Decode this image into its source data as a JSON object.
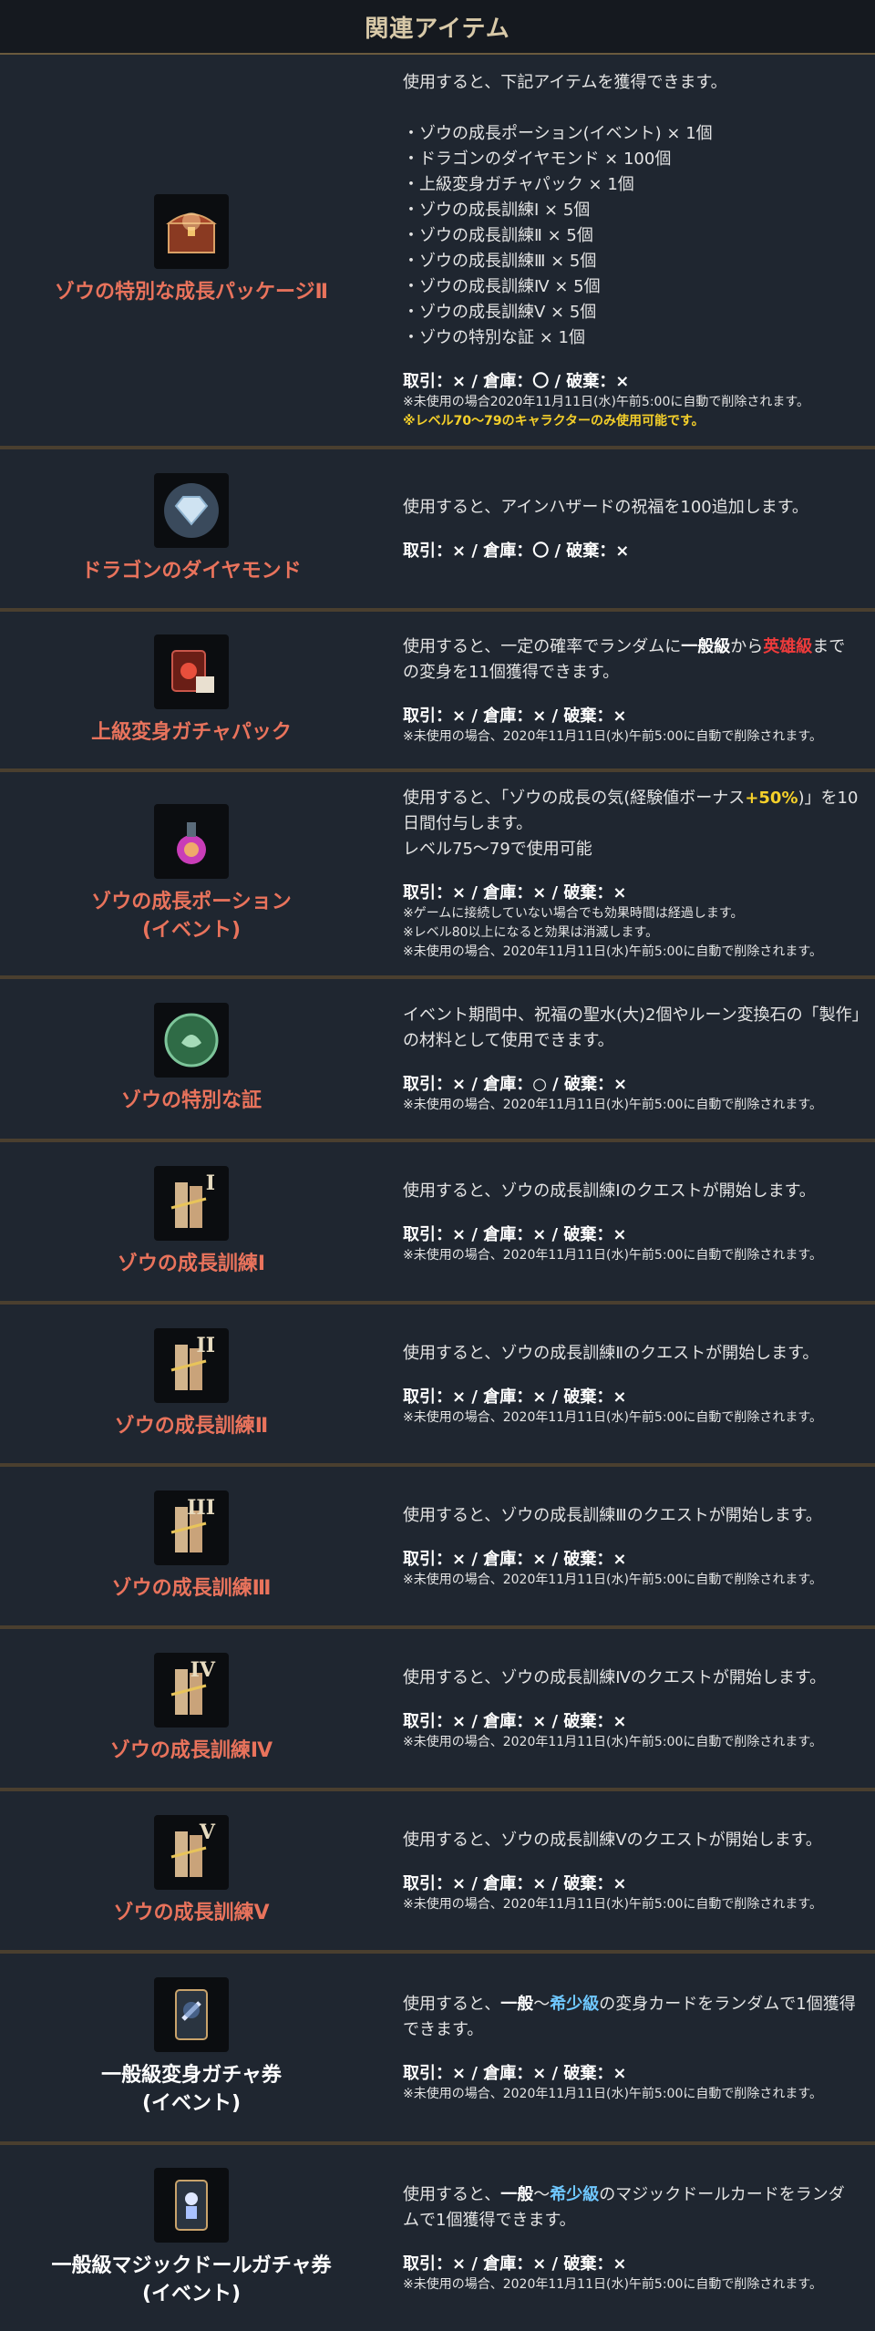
{
  "header": {
    "title": "関連アイテム"
  },
  "items": [
    {
      "name": "ゾウの特別な成長パッケージⅡ",
      "desc": "使用すると、下記アイテムを獲得できます。",
      "list": [
        "・ゾウの成長ポーション(イベント) × 1個",
        "・ドラゴンのダイヤモンド × 100個",
        "・上級変身ガチャパック × 1個",
        "・ゾウの成長訓練Ⅰ × 5個",
        "・ゾウの成長訓練Ⅱ × 5個",
        "・ゾウの成長訓練Ⅲ × 5個",
        "・ゾウの成長訓練Ⅳ × 5個",
        "・ゾウの成長訓練Ⅴ × 5個",
        "・ゾウの特別な証 × 1個"
      ],
      "meta": "取引：× / 倉庫：〇 / 破棄：×",
      "note1": "※未使用の場合2020年11月11日(水)午前5:00に自動で削除されます。",
      "note2": "※レベル70～79のキャラクターのみ使用可能です。"
    },
    {
      "name": "ドラゴンのダイヤモンド",
      "desc": "使用すると、アインハザードの祝福を100追加します。",
      "meta": "取引：× / 倉庫：〇 / 破棄：×"
    },
    {
      "name": "上級変身ガチャパック",
      "desc_a": "使用すると、一定の確率でランダムに",
      "desc_b": "一般級",
      "desc_c": "から",
      "desc_d": "英雄級",
      "desc_e": "までの変身を11個獲得できます。",
      "meta": "取引：× / 倉庫：× / 破棄：×",
      "note1": "※未使用の場合、2020年11月11日(水)午前5:00に自動で削除されます。"
    },
    {
      "name": "ゾウの成長ポーション",
      "name2": "(イベント)",
      "desc_a": "使用すると、「ゾウの成長の気(経験値ボーナス",
      "desc_b": "+50%",
      "desc_c": ")」を10日間付与します。",
      "desc_d": "レベル75～79で使用可能",
      "meta": "取引：× / 倉庫：× / 破棄：×",
      "note1": "※ゲームに接続していない場合でも効果時間は経過します。",
      "note2": "※レベル80以上になると効果は消滅します。",
      "note3": "※未使用の場合、2020年11月11日(水)午前5:00に自動で削除されます。"
    },
    {
      "name": "ゾウの特別な証",
      "desc": "イベント期間中、祝福の聖水(大)2個やルーン変換石の「製作」の材料として使用できます。",
      "meta": "取引：× / 倉庫：○ / 破棄：×",
      "note1": "※未使用の場合、2020年11月11日(水)午前5:00に自動で削除されます。"
    },
    {
      "name": "ゾウの成長訓練Ⅰ",
      "roman": "I",
      "desc": "使用すると、ゾウの成長訓練Ⅰのクエストが開始します。",
      "meta": "取引：× / 倉庫：× / 破棄：×",
      "note1": "※未使用の場合、2020年11月11日(水)午前5:00に自動で削除されます。"
    },
    {
      "name": "ゾウの成長訓練Ⅱ",
      "roman": "II",
      "desc": "使用すると、ゾウの成長訓練Ⅱのクエストが開始します。",
      "meta": "取引：× / 倉庫：× / 破棄：×",
      "note1": "※未使用の場合、2020年11月11日(水)午前5:00に自動で削除されます。"
    },
    {
      "name": "ゾウの成長訓練Ⅲ",
      "roman": "III",
      "desc": "使用すると、ゾウの成長訓練Ⅲのクエストが開始します。",
      "meta": "取引：× / 倉庫：× / 破棄：×",
      "note1": "※未使用の場合、2020年11月11日(水)午前5:00に自動で削除されます。"
    },
    {
      "name": "ゾウの成長訓練Ⅳ",
      "roman": "IV",
      "desc": "使用すると、ゾウの成長訓練Ⅳのクエストが開始します。",
      "meta": "取引：× / 倉庫：× / 破棄：×",
      "note1": "※未使用の場合、2020年11月11日(水)午前5:00に自動で削除されます。"
    },
    {
      "name": "ゾウの成長訓練Ⅴ",
      "roman": "V",
      "desc": "使用すると、ゾウの成長訓練Ⅴのクエストが開始します。",
      "meta": "取引：× / 倉庫：× / 破棄：×",
      "note1": "※未使用の場合、2020年11月11日(水)午前5:00に自動で削除されます。"
    },
    {
      "name": "一般級変身ガチャ券",
      "name2": "(イベント)",
      "desc_a": "使用すると、",
      "desc_b": "一般",
      "desc_c": "～",
      "desc_d": "希少級",
      "desc_e": "の変身カードをランダムで1個獲得できます。",
      "meta": "取引：× / 倉庫：× / 破棄：×",
      "note1": "※未使用の場合、2020年11月11日(水)午前5:00に自動で削除されます。"
    },
    {
      "name": "一般級マジックドールガチャ券",
      "name2": "(イベント)",
      "desc_a": "使用すると、",
      "desc_b": "一般",
      "desc_c": "～",
      "desc_d": "希少級",
      "desc_e": "のマジックドールカードをランダムで1個獲得できます。",
      "meta": "取引：× / 倉庫：× / 破棄：×",
      "note1": "※未使用の場合、2020年11月11日(水)午前5:00に自動で削除されます。"
    }
  ]
}
